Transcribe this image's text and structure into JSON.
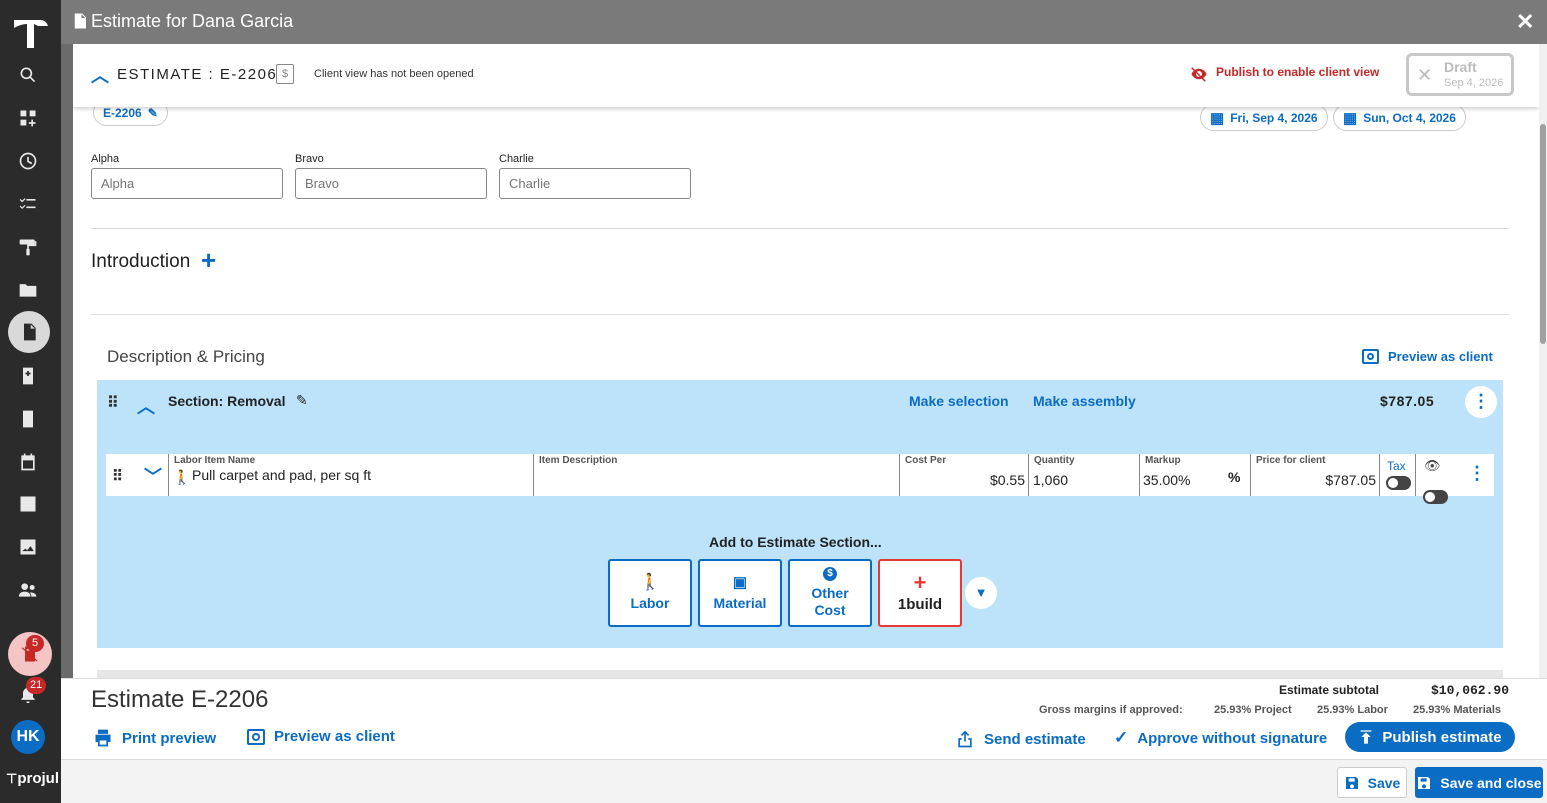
{
  "window": {
    "title": "Estimate for Dana Garcia",
    "close_icon": "close-icon"
  },
  "sidebar": {
    "logo": "hammer-logo",
    "items": [
      "search-icon",
      "dashboard-icon",
      "clock-icon",
      "checklist-icon",
      "roller-icon",
      "folder-icon",
      "estimate-icon",
      "invoice-icon",
      "bill-icon",
      "calendar-icon",
      "task-icon",
      "photo-icon",
      "people-icon"
    ],
    "alert_badge": "5",
    "notifications_badge": "21",
    "avatar_initials": "HK",
    "brand": "projul"
  },
  "header": {
    "estimate_label": "ESTIMATE : E-2206",
    "client_view_status": "Client view has not been opened",
    "publish_notice": "Publish to enable client view",
    "stamp_status": "Draft",
    "stamp_date": "Sep 4, 2026"
  },
  "meta": {
    "estimate_number": "E-2206",
    "date_start": "Fri, Sep 4, 2026",
    "date_end": "Sun, Oct 4, 2026"
  },
  "custom_fields": [
    {
      "label": "Alpha",
      "placeholder": "Alpha"
    },
    {
      "label": "Bravo",
      "placeholder": "Bravo"
    },
    {
      "label": "Charlie",
      "placeholder": "Charlie"
    }
  ],
  "introduction": {
    "label": "Introduction"
  },
  "pricing": {
    "title": "Description & Pricing",
    "preview_label": "Preview as client",
    "section": {
      "title": "Section: Removal",
      "make_selection": "Make selection",
      "make_assembly": "Make assembly",
      "total": "$787.05"
    },
    "line_item": {
      "name_label": "Labor Item Name",
      "name": "Pull carpet and pad, per sq ft",
      "description_label": "Item Description",
      "description": "",
      "cost_label": "Cost Per",
      "cost": "$0.55",
      "quantity_label": "Quantity",
      "quantity": "1,060",
      "markup_label": "Markup",
      "markup": "35.00%",
      "markup_unit": "%",
      "price_label": "Price for client",
      "price": "$787.05",
      "tax_label": "Tax"
    },
    "add_section": {
      "title": "Add to Estimate Section...",
      "buttons": [
        "Labor",
        "Material",
        "Other Cost",
        "1build"
      ]
    }
  },
  "footer": {
    "title": "Estimate E-2206",
    "subtotal_label": "Estimate subtotal",
    "subtotal_value": "$10,062.90",
    "margins_label": "Gross margins if approved:",
    "margin_project": "25.93% Project",
    "margin_labor": "25.93% Labor",
    "margin_materials": "25.93% Materials",
    "print_preview": "Print preview",
    "preview_client": "Preview as client",
    "send_estimate": "Send estimate",
    "approve": "Approve without signature",
    "publish": "Publish estimate"
  },
  "bottombar": {
    "save": "Save",
    "save_close": "Save and close"
  },
  "colors": {
    "accent": "#0b6cc4",
    "section_bg": "#bde3fa",
    "danger": "#c62828"
  }
}
